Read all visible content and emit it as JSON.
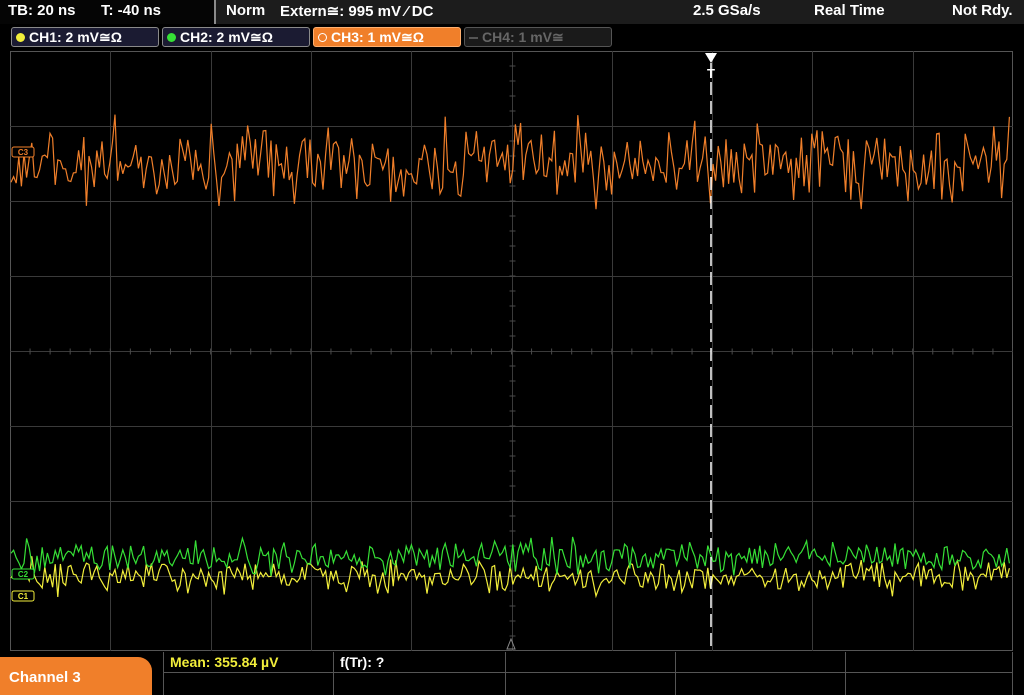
{
  "topbar": {
    "timebase": "TB: 20 ns",
    "trigger_time": "T: -40 ns",
    "mode": "Norm",
    "trigger_source": "Extern≅: 995 mV ⁄ DC",
    "sample_rate": "2.5 GSa/s",
    "acq_mode": "Real Time",
    "status": "Not Rdy."
  },
  "channels": [
    {
      "label": "CH1: 2 mV≅Ω",
      "color": "#f2ee3b",
      "state": "on"
    },
    {
      "label": "CH2: 2 mV≅Ω",
      "color": "#36e036",
      "state": "on"
    },
    {
      "label": "CH3: 1 mV≅Ω",
      "color": "#f07f2a",
      "state": "active"
    },
    {
      "label": "CH4: 1 mV≅",
      "color": "#5a5a5a",
      "state": "disabled"
    }
  ],
  "markers": {
    "ch3": "C3",
    "ch2": "C2",
    "ch1": "C1",
    "trigger": "T"
  },
  "waveform_levels": {
    "ch3_div": -2.5,
    "ch2_div": 2.75,
    "ch1_div": 3.0
  },
  "colors": {
    "accent": "#f07f2a",
    "grid": "#3a3a3a",
    "ch1": "#f2ee3b",
    "ch2": "#36e036",
    "ch3": "#f07f2a"
  },
  "bottom": {
    "active_channel": "Channel 3",
    "mean_label": "Mean: 355.84 µV",
    "f_tr_label": "f(Tr): ?"
  }
}
